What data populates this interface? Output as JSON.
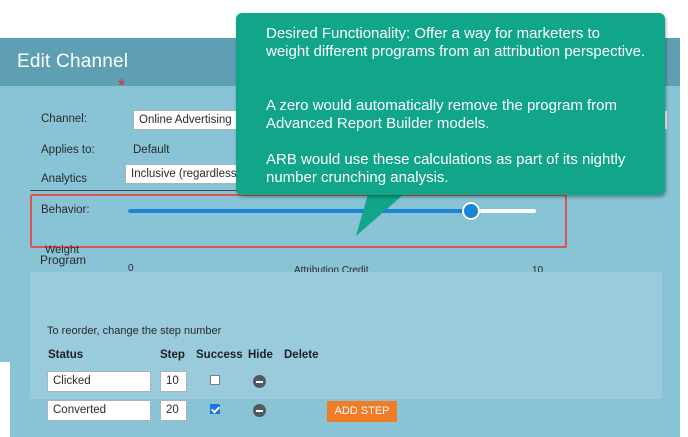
{
  "dialog": {
    "title": "Edit Channel",
    "channel_label": "Channel:",
    "channel_value": "Online Advertising",
    "applies_label": "Applies to:",
    "applies_value": "Default",
    "analytics_label": "Analytics",
    "behavior_label": "Behavior:",
    "behavior_value": "Inclusive (regardless of period cé"
  },
  "weight": {
    "label": "Weight",
    "min_label": "0",
    "max_label": "10",
    "caption": "Attribution Credit",
    "value": 8.4,
    "min": 0,
    "max": 10
  },
  "program": {
    "title": "Program",
    "hint": "To reorder, change the step number",
    "headers": {
      "status": "Status",
      "step": "Step",
      "success": "Success",
      "hide": "Hide",
      "delete": "Delete"
    },
    "rows": [
      {
        "status": "Clicked",
        "step": "10",
        "success": false
      },
      {
        "status": "Converted",
        "step": "20",
        "success": true
      }
    ],
    "add_step_label": "ADD STEP"
  },
  "callout": {
    "paragraph_1": "Desired Functionality: Offer a way for marketers to weight different programs from an attribution perspective.",
    "paragraph_2": "A zero would automatically remove the program from Advanced Report Builder models.",
    "paragraph_3": "ARB would use these calculations as part of its nightly number crunching analysis.",
    "color": "#11a589"
  },
  "colors": {
    "header": "#5f9fb4",
    "panel": "#89c3d6",
    "slider": "#1a84d6",
    "highlight_border": "#e05252",
    "add_step": "#f07c27"
  }
}
